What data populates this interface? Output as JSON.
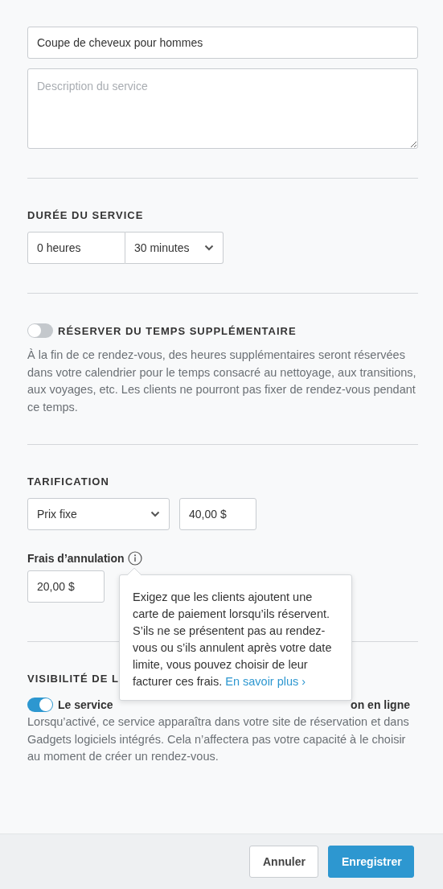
{
  "service_name": {
    "value": "Coupe de cheveux pour hommes"
  },
  "description": {
    "placeholder": "Description du service"
  },
  "duration": {
    "heading": "DURÉE DU SERVICE",
    "hours": {
      "value": "0 heures"
    },
    "minutes": {
      "value": "30 minutes"
    }
  },
  "extra_time": {
    "on": false,
    "label": "RÉSERVER DU TEMPS SUPPLÉMENTAIRE",
    "description": "À la fin de ce rendez-vous, des heures supplémentaires seront réservées dans votre calendrier pour le temps consacré au nettoyage, aux transitions, aux voyages, etc. Les clients ne pourront pas fixer de rendez-vous pendant ce temps."
  },
  "pricing": {
    "heading": "TARIFICATION",
    "type": {
      "value": "Prix fixe"
    },
    "price": {
      "value": "40,00 $"
    }
  },
  "cancellation_fee": {
    "label": "Frais d’annulation",
    "value": "20,00 $",
    "tooltip": {
      "text": "Exigez que les clients ajoutent une carte de paiement lorsqu’ils réservent. S’ils ne se présentent pas au rendez-vous ou s’ils annulent après votre date limite, vous pouvez choisir de leur facturer ces frais.",
      "link": "En savoir plus ›"
    }
  },
  "visibility": {
    "heading": "VISIBILITÉ DE L",
    "on": true,
    "label_start": "Le service",
    "label_end": "on en ligne",
    "description": "Lorsqu’activé, ce service apparaîtra dans votre site de réservation et dans Gadgets logiciels intégrés. Cela n’affectera pas votre capacité à le choisir au moment de créer un rendez-vous."
  },
  "buttons": [
    {
      "label": "Annuler",
      "kind": "secondary"
    },
    {
      "label": "Enregistrer",
      "kind": "primary"
    }
  ]
}
